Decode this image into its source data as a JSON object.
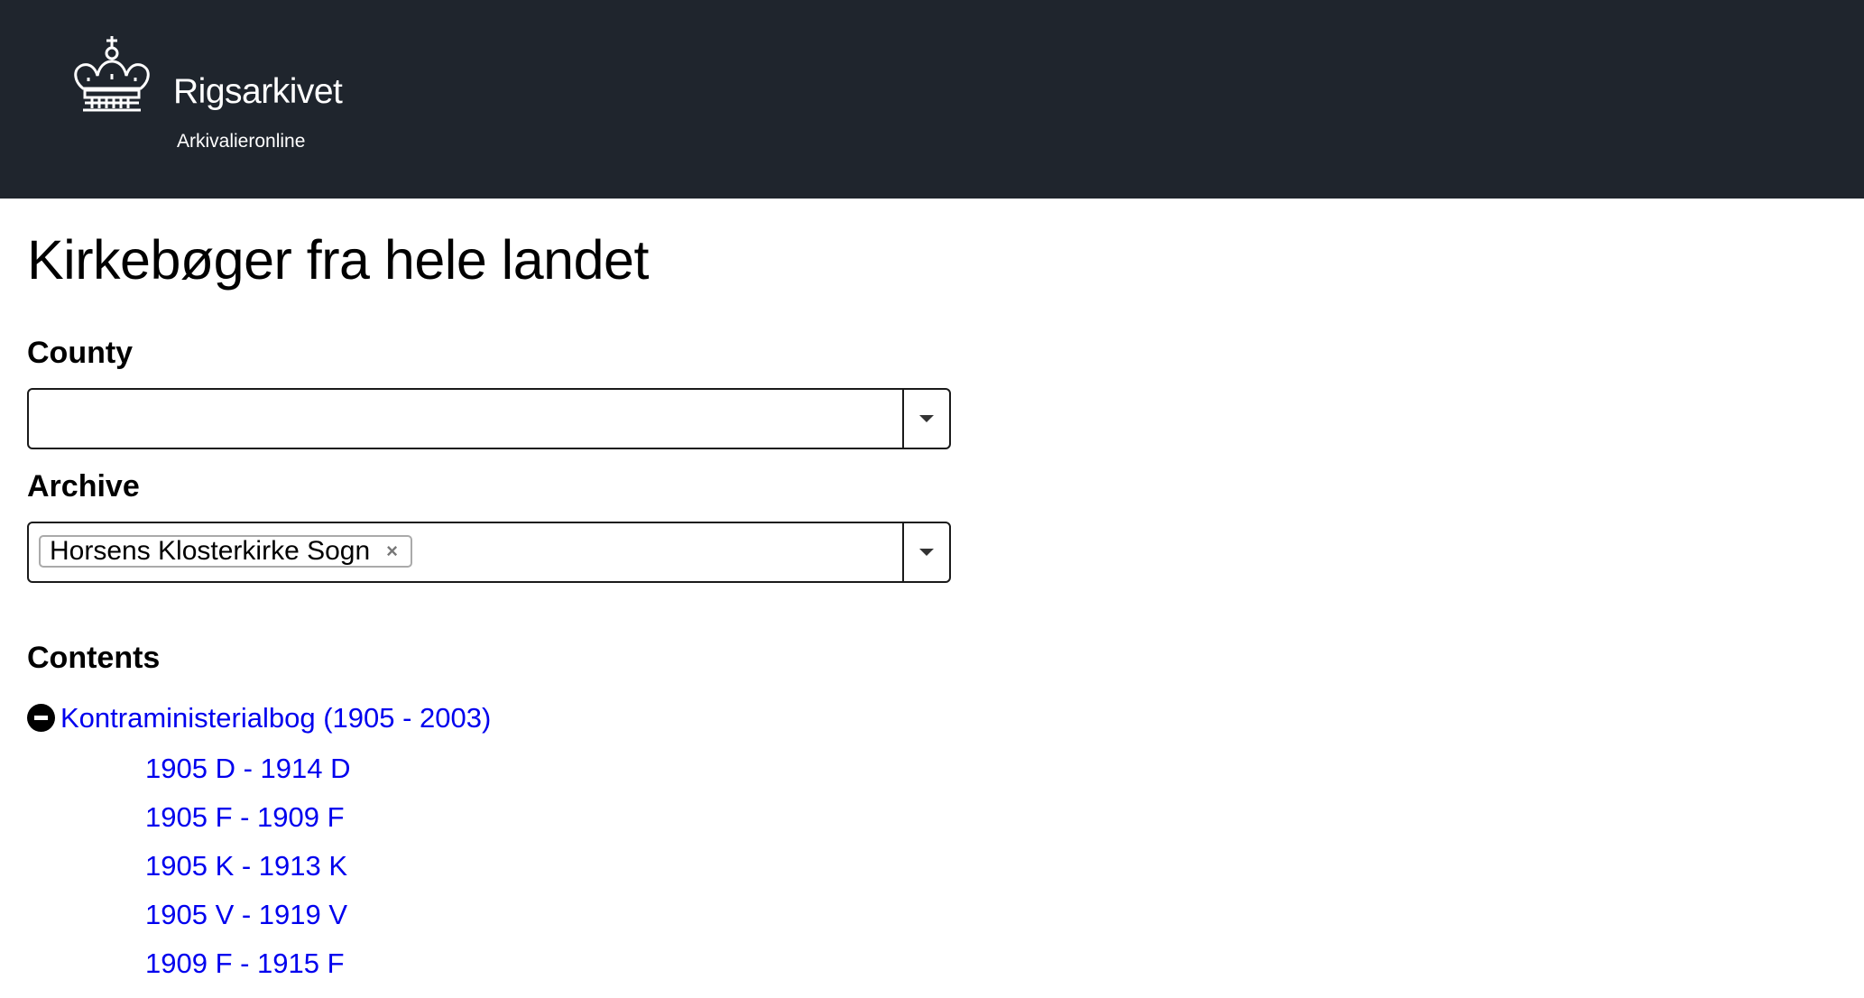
{
  "header": {
    "brand_name": "Rigsarkivet",
    "brand_subtitle": "Arkivalieronline",
    "logo_icon": "crown-icon",
    "background_color": "#1f252d"
  },
  "page": {
    "title": "Kirkebøger fra hele landet"
  },
  "filters": {
    "county": {
      "label": "County",
      "value": ""
    },
    "archive": {
      "label": "Archive",
      "selected_tag": "Horsens Klosterkirke Sogn",
      "remove_symbol": "×"
    }
  },
  "contents": {
    "label": "Contents",
    "root": {
      "label": "Kontraministerialbog (1905 - 2003)",
      "expanded": true
    },
    "children": [
      {
        "label": "1905 D - 1914 D"
      },
      {
        "label": "1905 F - 1909 F"
      },
      {
        "label": "1905 K - 1913 K"
      },
      {
        "label": "1905 V - 1919 V"
      },
      {
        "label": "1909 F - 1915 F"
      }
    ]
  },
  "colors": {
    "link": "#0000ee"
  }
}
